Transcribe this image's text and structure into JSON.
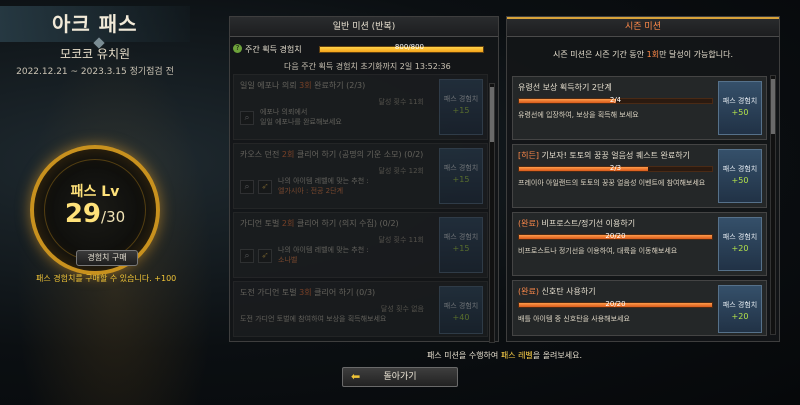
{
  "pass": {
    "title": "아크 패스",
    "season_name": "모코코 유치원",
    "season_date": "2022.12.21 ~ 2023.3.15 정기점검 전",
    "level_label": "패스 Lv",
    "level": "29",
    "level_max": "/30",
    "buy_button": "경험치 구매",
    "notice": "패스 경험치를 구매할 수 있습니다. +100"
  },
  "weekly": {
    "tab_label": "일반 미션 (반복)",
    "xp_label": "주간 획득 경험치",
    "xp_text": "800/800",
    "xp_fraction": 1.0,
    "reset_text": "다음 주간 획득 경험치 초기화까지 2일 13:52:36",
    "missions": [
      {
        "title_pre": "일일 에포나 의뢰 ",
        "title_hl": "3회",
        "title_post": " 완료하기 (2/3)",
        "count": "달성 횟수 11회",
        "desc": "에포나 의뢰에서",
        "desc2": "일일 에포나를 완료해보세요",
        "reward_label": "패스 경험치",
        "reward": "+15"
      },
      {
        "title_pre": "카오스 던전 ",
        "title_hl": "2회",
        "title_post": " 클리어 하기 (공명의 기운 소모) (0/2)",
        "count": "달성 횟수 12회",
        "desc": "나의 아이템 레벨에 맞는 추천 :",
        "desc2": "엘가시아 : 전공 2단계",
        "reward_label": "패스 경험치",
        "reward": "+15"
      },
      {
        "title_pre": "가디언 토벌 ",
        "title_hl": "2회",
        "title_post": " 클리어 하기 (의지 수집) (0/2)",
        "count": "달성 횟수 11회",
        "desc": "나의 아이템 레벨에 맞는 추천 :",
        "desc2": "소나벨",
        "reward_label": "패스 경험치",
        "reward": "+15"
      },
      {
        "title_pre": "도전 가디언 토벌 ",
        "title_hl": "3회",
        "title_post": " 클리어 하기 (0/3)",
        "count": "달성 횟수 없음",
        "desc": "도전 가디언 토벌에 참여하여 보상을 획득해보세요",
        "desc2": "",
        "reward_label": "패스 경험치",
        "reward": "+40"
      }
    ]
  },
  "season": {
    "tab_label": "시즌 미션",
    "desc_pre": "시즌 미션은 시즌 기간 동안 ",
    "desc_hl": "1회",
    "desc_post": "만 달성이 가능합니다.",
    "missions": [
      {
        "tag": "",
        "title": "유령선 보상 획득하기 2단계",
        "progress": "2/4",
        "fraction": 0.5,
        "desc": "유령선에 입장하여, 보상을 획득해 보세요",
        "reward_label": "패스 경험치",
        "reward": "+50",
        "done": false
      },
      {
        "tag": "[히든]",
        "title": " 기보자! 토토의 꿍꿍 얼음성 퀘스트 완료하기",
        "progress": "2/3",
        "fraction": 0.667,
        "desc": "프레이아 아일랜드의 토토의 꿍꿍 얼음성 이벤트에 참여해보세요",
        "reward_label": "패스 경험치",
        "reward": "+50",
        "done": false
      },
      {
        "tag": "(완료)",
        "title": " 비프로스트/정기선 이용하기",
        "progress": "20/20",
        "fraction": 1.0,
        "desc": "비프로스트나 정기선을 이용하여, 대륙을 이동해보세요",
        "reward_label": "패스 경험치",
        "reward": "+20",
        "done": true
      },
      {
        "tag": "(완료)",
        "title": " 신호탄 사용하기",
        "progress": "20/20",
        "fraction": 1.0,
        "desc": "배틀 아이템 중 신호탄을 사용해보세요",
        "reward_label": "패스 경험치",
        "reward": "+20",
        "done": true
      }
    ]
  },
  "footer": {
    "text_pre": "패스 미션을 수행하여 ",
    "text_hl": "패스 레벨",
    "text_post": "을 올려보세요.",
    "back_button": "돌아가기"
  }
}
